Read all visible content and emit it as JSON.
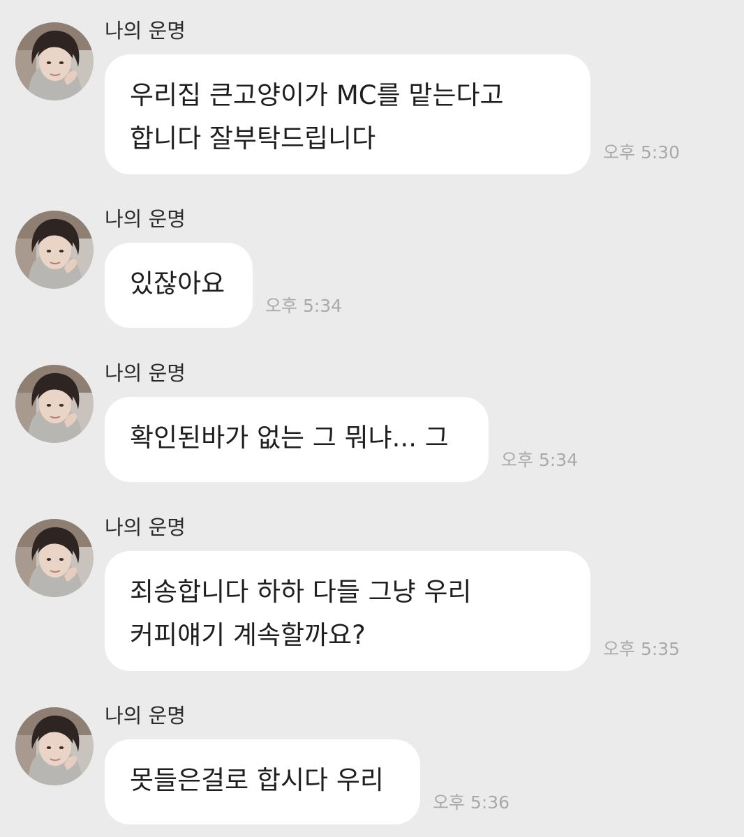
{
  "chat": {
    "messages": [
      {
        "sender": "나의 운명",
        "lines": [
          "우리집 큰고양이가 MC를 맡는다고",
          "합니다 잘부탁드립니다"
        ],
        "time": "오후 5:30"
      },
      {
        "sender": "나의 운명",
        "lines": [
          "있잖아요"
        ],
        "time": "오후 5:34"
      },
      {
        "sender": "나의 운명",
        "lines": [
          "확인된바가 없는 그 뭐냐... 그"
        ],
        "time": "오후 5:34"
      },
      {
        "sender": "나의 운명",
        "lines": [
          "죄송합니다 하하 다들 그냥 우리",
          "커피얘기 계속할까요?"
        ],
        "time": "오후 5:35"
      },
      {
        "sender": "나의 운명",
        "lines": [
          "못들은걸로 합시다 우리"
        ],
        "time": "오후 5:36"
      }
    ]
  }
}
